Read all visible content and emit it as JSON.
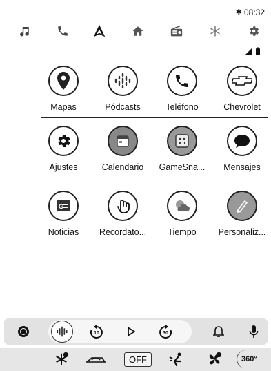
{
  "status": {
    "bluetooth": "✱",
    "time": "08:32"
  },
  "topnav": {
    "icons": [
      "music-icon",
      "phone-icon",
      "android-auto-icon",
      "home-icon",
      "radio-icon",
      "climate-icon",
      "settings-icon"
    ]
  },
  "apps": [
    {
      "label": "Mapas",
      "icon": "maps-icon"
    },
    {
      "label": "Pódcasts",
      "icon": "podcasts-icon"
    },
    {
      "label": "Teléfono",
      "icon": "phone-icon"
    },
    {
      "label": "Chevrolet",
      "icon": "chevrolet-icon"
    },
    {
      "label": "Ajustes",
      "icon": "settings-icon"
    },
    {
      "label": "Calendario",
      "icon": "calendar-icon"
    },
    {
      "label": "GameSna...",
      "icon": "gamesnacks-icon"
    },
    {
      "label": "Mensajes",
      "icon": "messages-icon"
    },
    {
      "label": "Noticias",
      "icon": "news-icon"
    },
    {
      "label": "Recordato...",
      "icon": "reminder-icon"
    },
    {
      "label": "Tiempo",
      "icon": "weather-icon"
    },
    {
      "label": "Personaliz...",
      "icon": "customize-icon"
    }
  ],
  "media": {
    "rewind_label": "10",
    "forward_label": "30"
  },
  "climate": {
    "off_label": "OFF",
    "view_label": "360°"
  }
}
